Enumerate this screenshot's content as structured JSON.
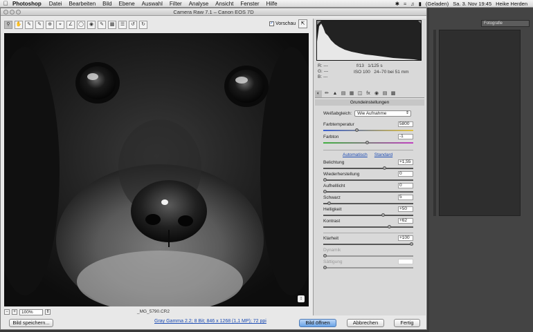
{
  "menubar": {
    "app": "Photoshop",
    "items": [
      "Datei",
      "Bearbeiten",
      "Bild",
      "Ebene",
      "Auswahl",
      "Filter",
      "Analyse",
      "Ansicht",
      "Fenster",
      "Hilfe"
    ],
    "battery": "(Geladen)",
    "clock": "Sa. 3. Nov 19:45",
    "user": "Heike Herden"
  },
  "ps": {
    "workspace": "Fotografie"
  },
  "window": {
    "title": "Camera Raw 7.1 – Canon EOS 7D",
    "preview_label": "Vorschau",
    "zoom": "100%",
    "filename": "_MG_5790.CR2"
  },
  "readout": {
    "r": "R:",
    "g": "G:",
    "b": "B:",
    "r_val": "---",
    "g_val": "---",
    "b_val": "---",
    "aperture": "f/13",
    "shutter": "1/125 s",
    "iso": "ISO 100",
    "lens": "24–70 bei 51 mm"
  },
  "panel": {
    "title": "Grundeinstellungen",
    "wb_label": "Weißabgleich:",
    "wb_value": "Wie Aufnahme",
    "auto": "Automatisch",
    "standard": "Standard",
    "sliders": [
      {
        "label": "Farbtemperatur",
        "value": "5800",
        "pos": 0.37
      },
      {
        "label": "Farbton",
        "value": "-1",
        "pos": 0.49
      },
      {
        "label": "Belichtung",
        "value": "+1,55",
        "pos": 0.69
      },
      {
        "label": "Wiederherstellung",
        "value": "0",
        "pos": 0.0
      },
      {
        "label": "Aufhelllicht",
        "value": "0",
        "pos": 0.0
      },
      {
        "label": "Schwarz",
        "value": "5",
        "pos": 0.05
      },
      {
        "label": "Helligkeit",
        "value": "+50",
        "pos": 0.67
      },
      {
        "label": "Kontrast",
        "value": "+62",
        "pos": 0.74
      },
      {
        "label": "Klarheit",
        "value": "+100",
        "pos": 1.0
      },
      {
        "label": "Dynamik",
        "value": "",
        "pos": 0.0
      },
      {
        "label": "Sättigung",
        "value": "",
        "pos": 0.0
      }
    ]
  },
  "buttons": {
    "save": "Bild speichern...",
    "info_link": "Gray Gamma 2.2; 8 Bit; 846 x 1268 (1,1 MP); 72 ppi",
    "open": "Bild öffnen",
    "cancel": "Abbrechen",
    "done": "Fertig"
  },
  "colors": {
    "accent": "#6aa3e6",
    "link": "#1a4ab3"
  }
}
